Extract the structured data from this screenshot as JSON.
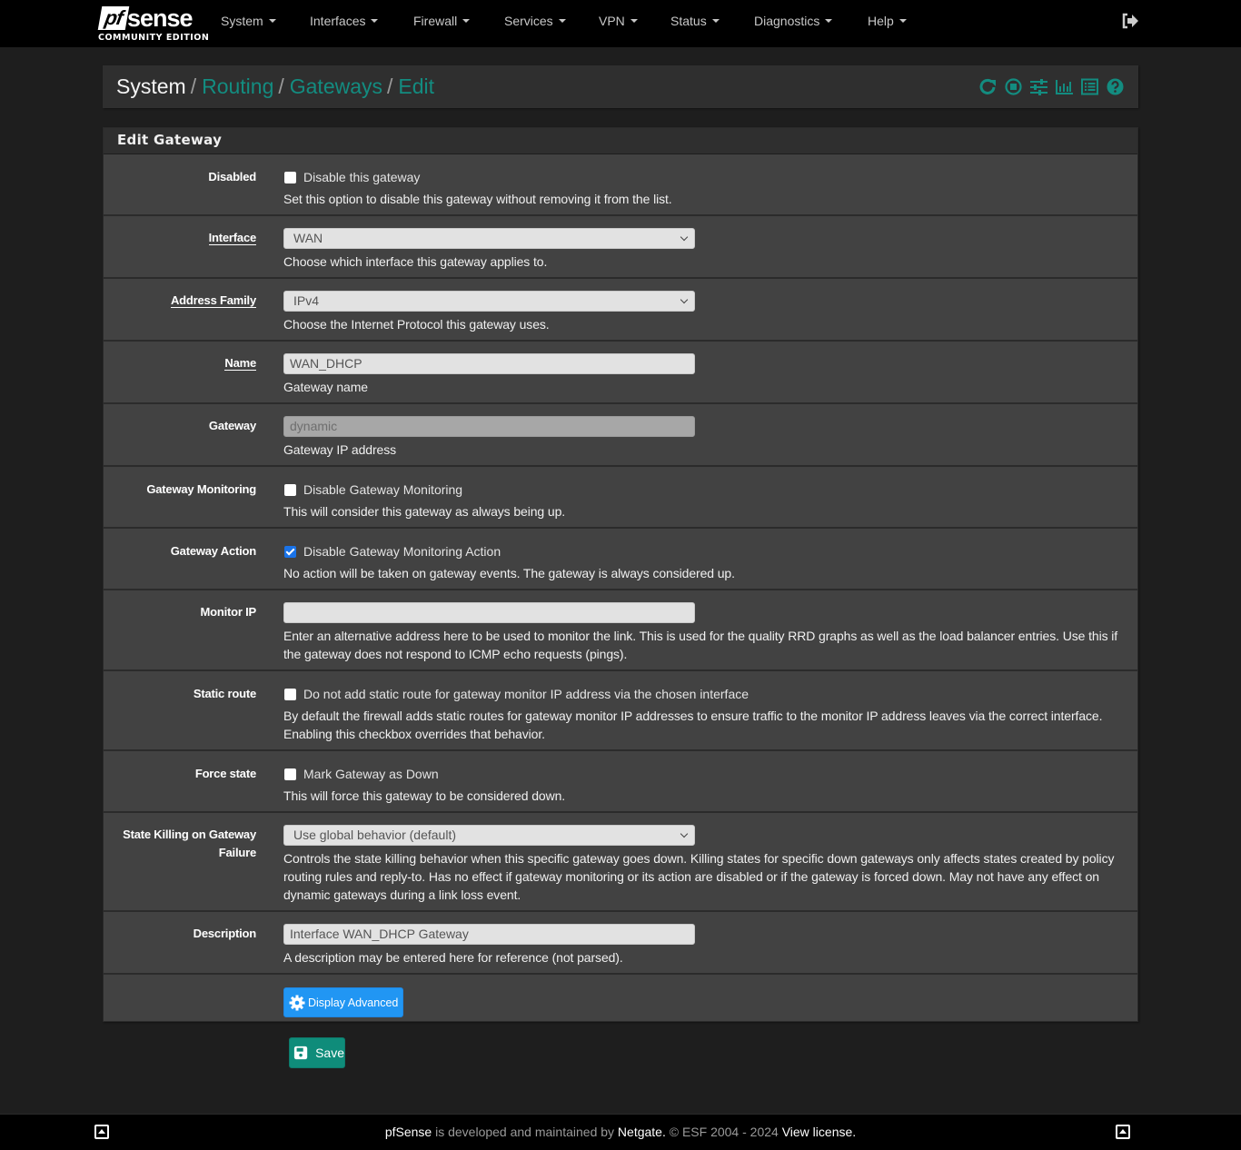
{
  "brand": {
    "logo_pf": "pf",
    "logo_sense": "sense",
    "edition": "COMMUNITY EDITION"
  },
  "nav": {
    "items": [
      {
        "label": "System"
      },
      {
        "label": "Interfaces"
      },
      {
        "label": "Firewall"
      },
      {
        "label": "Services"
      },
      {
        "label": "VPN"
      },
      {
        "label": "Status"
      },
      {
        "label": "Diagnostics"
      },
      {
        "label": "Help"
      }
    ],
    "logout_icon": "sign-out-icon"
  },
  "breadcrumb": {
    "items": [
      "System",
      "Routing",
      "Gateways",
      "Edit"
    ],
    "separator": "/",
    "icons": [
      "reload-icon",
      "stop-circle-icon",
      "sliders-icon",
      "bar-chart-icon",
      "list-alt-icon",
      "question-circle-icon"
    ]
  },
  "colors": {
    "accent": "#138c80",
    "primary_button": "#2196f3",
    "save_button": "#0f8c7a",
    "panel_bg": "#424242",
    "page_bg": "#1e1e1e"
  },
  "panel": {
    "title": "Edit Gateway",
    "fields": {
      "disabled": {
        "label": "Disabled",
        "checkbox_label": "Disable this gateway",
        "checked": false,
        "help": "Set this option to disable this gateway without removing it from the list."
      },
      "interface": {
        "label": "Interface",
        "value": "WAN",
        "help": "Choose which interface this gateway applies to."
      },
      "address_family": {
        "label": "Address Family",
        "value": "IPv4",
        "help": "Choose the Internet Protocol this gateway uses."
      },
      "name": {
        "label": "Name",
        "value": "WAN_DHCP",
        "help": "Gateway name"
      },
      "gateway": {
        "label": "Gateway",
        "value": "dynamic",
        "help": "Gateway IP address"
      },
      "gateway_monitoring": {
        "label": "Gateway Monitoring",
        "checkbox_label": "Disable Gateway Monitoring",
        "checked": false,
        "help": "This will consider this gateway as always being up."
      },
      "gateway_action": {
        "label": "Gateway Action",
        "checkbox_label": "Disable Gateway Monitoring Action",
        "checked": true,
        "help": "No action will be taken on gateway events. The gateway is always considered up."
      },
      "monitor_ip": {
        "label": "Monitor IP",
        "value": "",
        "help": "Enter an alternative address here to be used to monitor the link. This is used for the quality RRD graphs as well as the load balancer entries. Use this if the gateway does not respond to ICMP echo requests (pings)."
      },
      "static_route": {
        "label": "Static route",
        "checkbox_label": "Do not add static route for gateway monitor IP address via the chosen interface",
        "checked": false,
        "help": "By default the firewall adds static routes for gateway monitor IP addresses to ensure traffic to the monitor IP address leaves via the correct interface. Enabling this checkbox overrides that behavior."
      },
      "force_state": {
        "label": "Force state",
        "checkbox_label": "Mark Gateway as Down",
        "checked": false,
        "help": "This will force this gateway to be considered down."
      },
      "state_killing": {
        "label": "State Killing on Gateway Failure",
        "value": "Use global behavior (default)",
        "help": "Controls the state killing behavior when this specific gateway goes down. Killing states for specific down gateways only affects states created by policy routing rules and reply-to. Has no effect if gateway monitoring or its action are disabled or if the gateway is forced down. May not have any effect on dynamic gateways during a link loss event."
      },
      "description": {
        "label": "Description",
        "value": "Interface WAN_DHCP Gateway",
        "help": "A description may be entered here for reference (not parsed)."
      }
    },
    "display_advanced_label": "Display Advanced"
  },
  "save_label": "Save",
  "footer": {
    "brand": "pfSense",
    "text1": " is developed and maintained by ",
    "company": "Netgate.",
    "text2": " © ESF 2004 - 2024 ",
    "license": "View license."
  }
}
